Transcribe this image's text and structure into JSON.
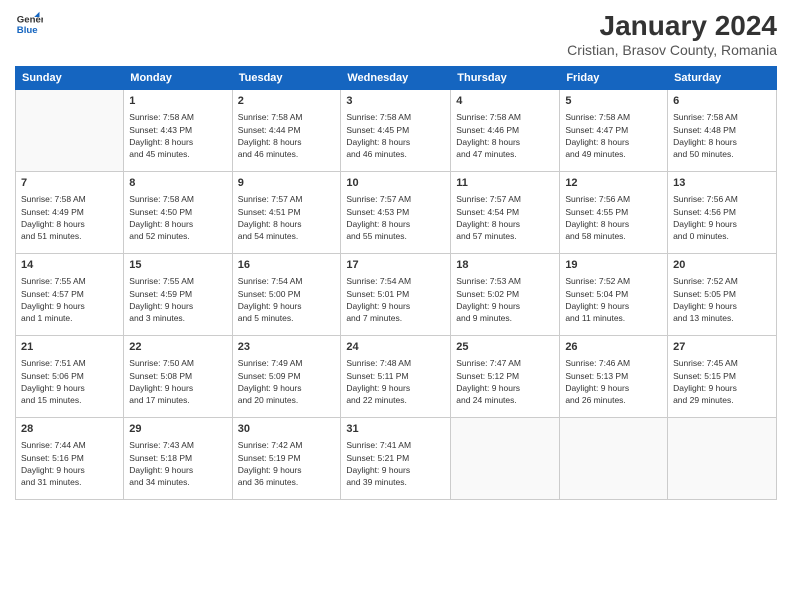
{
  "header": {
    "logo_line1": "General",
    "logo_line2": "Blue",
    "title": "January 2024",
    "subtitle": "Cristian, Brasov County, Romania"
  },
  "days_of_week": [
    "Sunday",
    "Monday",
    "Tuesday",
    "Wednesday",
    "Thursday",
    "Friday",
    "Saturday"
  ],
  "weeks": [
    [
      {
        "num": "",
        "info": ""
      },
      {
        "num": "1",
        "info": "Sunrise: 7:58 AM\nSunset: 4:43 PM\nDaylight: 8 hours\nand 45 minutes."
      },
      {
        "num": "2",
        "info": "Sunrise: 7:58 AM\nSunset: 4:44 PM\nDaylight: 8 hours\nand 46 minutes."
      },
      {
        "num": "3",
        "info": "Sunrise: 7:58 AM\nSunset: 4:45 PM\nDaylight: 8 hours\nand 46 minutes."
      },
      {
        "num": "4",
        "info": "Sunrise: 7:58 AM\nSunset: 4:46 PM\nDaylight: 8 hours\nand 47 minutes."
      },
      {
        "num": "5",
        "info": "Sunrise: 7:58 AM\nSunset: 4:47 PM\nDaylight: 8 hours\nand 49 minutes."
      },
      {
        "num": "6",
        "info": "Sunrise: 7:58 AM\nSunset: 4:48 PM\nDaylight: 8 hours\nand 50 minutes."
      }
    ],
    [
      {
        "num": "7",
        "info": "Sunrise: 7:58 AM\nSunset: 4:49 PM\nDaylight: 8 hours\nand 51 minutes."
      },
      {
        "num": "8",
        "info": "Sunrise: 7:58 AM\nSunset: 4:50 PM\nDaylight: 8 hours\nand 52 minutes."
      },
      {
        "num": "9",
        "info": "Sunrise: 7:57 AM\nSunset: 4:51 PM\nDaylight: 8 hours\nand 54 minutes."
      },
      {
        "num": "10",
        "info": "Sunrise: 7:57 AM\nSunset: 4:53 PM\nDaylight: 8 hours\nand 55 minutes."
      },
      {
        "num": "11",
        "info": "Sunrise: 7:57 AM\nSunset: 4:54 PM\nDaylight: 8 hours\nand 57 minutes."
      },
      {
        "num": "12",
        "info": "Sunrise: 7:56 AM\nSunset: 4:55 PM\nDaylight: 8 hours\nand 58 minutes."
      },
      {
        "num": "13",
        "info": "Sunrise: 7:56 AM\nSunset: 4:56 PM\nDaylight: 9 hours\nand 0 minutes."
      }
    ],
    [
      {
        "num": "14",
        "info": "Sunrise: 7:55 AM\nSunset: 4:57 PM\nDaylight: 9 hours\nand 1 minute."
      },
      {
        "num": "15",
        "info": "Sunrise: 7:55 AM\nSunset: 4:59 PM\nDaylight: 9 hours\nand 3 minutes."
      },
      {
        "num": "16",
        "info": "Sunrise: 7:54 AM\nSunset: 5:00 PM\nDaylight: 9 hours\nand 5 minutes."
      },
      {
        "num": "17",
        "info": "Sunrise: 7:54 AM\nSunset: 5:01 PM\nDaylight: 9 hours\nand 7 minutes."
      },
      {
        "num": "18",
        "info": "Sunrise: 7:53 AM\nSunset: 5:02 PM\nDaylight: 9 hours\nand 9 minutes."
      },
      {
        "num": "19",
        "info": "Sunrise: 7:52 AM\nSunset: 5:04 PM\nDaylight: 9 hours\nand 11 minutes."
      },
      {
        "num": "20",
        "info": "Sunrise: 7:52 AM\nSunset: 5:05 PM\nDaylight: 9 hours\nand 13 minutes."
      }
    ],
    [
      {
        "num": "21",
        "info": "Sunrise: 7:51 AM\nSunset: 5:06 PM\nDaylight: 9 hours\nand 15 minutes."
      },
      {
        "num": "22",
        "info": "Sunrise: 7:50 AM\nSunset: 5:08 PM\nDaylight: 9 hours\nand 17 minutes."
      },
      {
        "num": "23",
        "info": "Sunrise: 7:49 AM\nSunset: 5:09 PM\nDaylight: 9 hours\nand 20 minutes."
      },
      {
        "num": "24",
        "info": "Sunrise: 7:48 AM\nSunset: 5:11 PM\nDaylight: 9 hours\nand 22 minutes."
      },
      {
        "num": "25",
        "info": "Sunrise: 7:47 AM\nSunset: 5:12 PM\nDaylight: 9 hours\nand 24 minutes."
      },
      {
        "num": "26",
        "info": "Sunrise: 7:46 AM\nSunset: 5:13 PM\nDaylight: 9 hours\nand 26 minutes."
      },
      {
        "num": "27",
        "info": "Sunrise: 7:45 AM\nSunset: 5:15 PM\nDaylight: 9 hours\nand 29 minutes."
      }
    ],
    [
      {
        "num": "28",
        "info": "Sunrise: 7:44 AM\nSunset: 5:16 PM\nDaylight: 9 hours\nand 31 minutes."
      },
      {
        "num": "29",
        "info": "Sunrise: 7:43 AM\nSunset: 5:18 PM\nDaylight: 9 hours\nand 34 minutes."
      },
      {
        "num": "30",
        "info": "Sunrise: 7:42 AM\nSunset: 5:19 PM\nDaylight: 9 hours\nand 36 minutes."
      },
      {
        "num": "31",
        "info": "Sunrise: 7:41 AM\nSunset: 5:21 PM\nDaylight: 9 hours\nand 39 minutes."
      },
      {
        "num": "",
        "info": ""
      },
      {
        "num": "",
        "info": ""
      },
      {
        "num": "",
        "info": ""
      }
    ]
  ]
}
